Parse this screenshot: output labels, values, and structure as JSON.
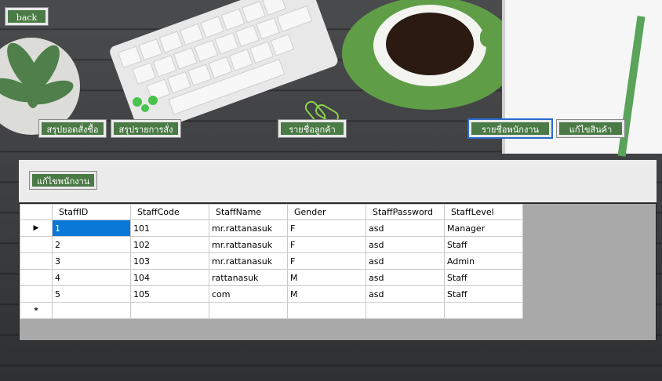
{
  "nav": {
    "back": "back",
    "order_summary": "สรุปยอดสั่งซื้อ",
    "item_summary": "สรุปรายการสั่ง",
    "customer_list": "รายชื่อลูกค้า",
    "staff_list": "รายชื่อพนักงาน",
    "edit_product": "แก้ไขสินค้า"
  },
  "toolbar": {
    "edit_staff": "แก้ไขพนักงาน"
  },
  "table": {
    "columns": [
      "StaffID",
      "StaffCode",
      "StaffName",
      "Gender",
      "StaffPassword",
      "StaffLevel"
    ],
    "rows": [
      [
        "1",
        "101",
        "mr.rattanasuk",
        "F",
        "asd",
        "Manager"
      ],
      [
        "2",
        "102",
        "mr.rattanasuk",
        "F",
        "asd",
        "Staff"
      ],
      [
        "3",
        "103",
        "mr.rattanasuk",
        "F",
        "asd",
        "Admin"
      ],
      [
        "4",
        "104",
        "rattanasuk",
        "M",
        "asd",
        "Staff"
      ],
      [
        "5",
        "105",
        "com",
        "M",
        "asd",
        "Staff"
      ]
    ],
    "current_row_marker": "▶",
    "new_row_marker": "*"
  },
  "colors": {
    "button": "#4a7a45",
    "selection": "#0a78d7"
  }
}
